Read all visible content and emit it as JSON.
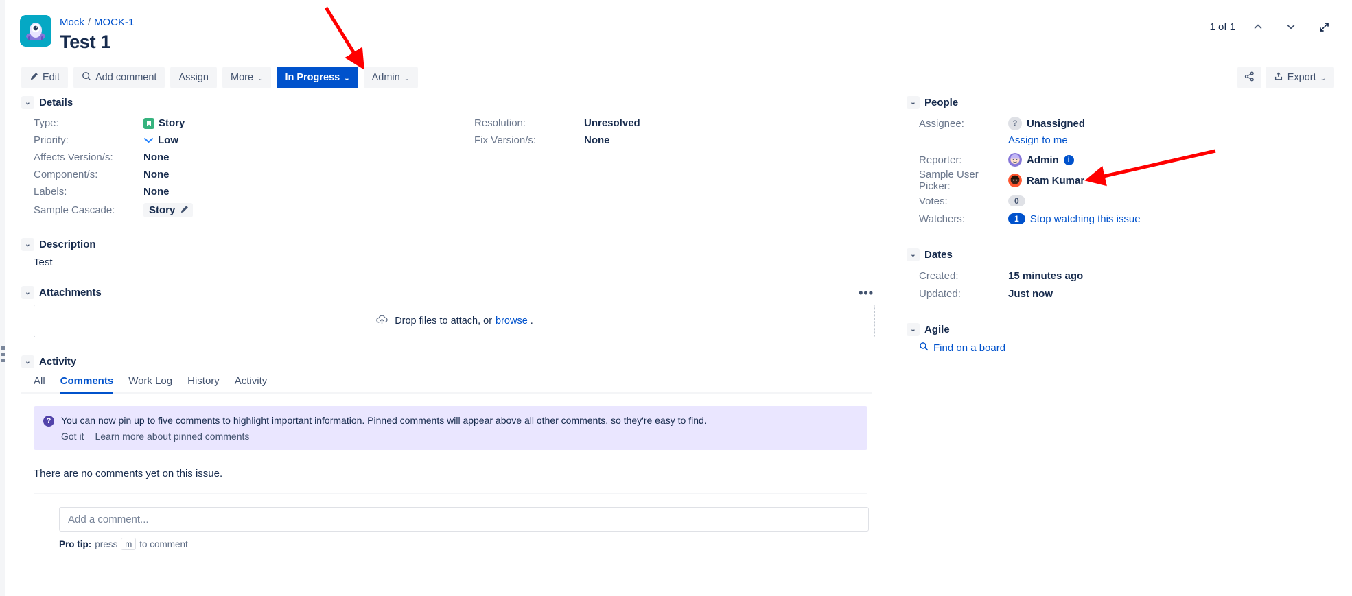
{
  "header": {
    "breadcrumb_project": "Mock",
    "breadcrumb_issue": "MOCK-1",
    "breadcrumb_separator": "/",
    "title": "Test 1",
    "pager_count": "1 of 1",
    "prev_icon": "chevron-up-icon",
    "next_icon": "chevron-down-icon",
    "expand_icon": "expand-icon",
    "project_avatar_icon": "project-avatar-icon"
  },
  "toolbar": {
    "edit_label": "Edit",
    "edit_icon": "pencil-icon",
    "add_comment_label": "Add comment",
    "add_comment_icon": "comment-icon",
    "assign_label": "Assign",
    "more_label": "More",
    "status_label": "In Progress",
    "admin_label": "Admin",
    "caret": "⌄",
    "share_icon": "share-icon",
    "export_label": "Export",
    "export_icon": "export-icon"
  },
  "details": {
    "heading": "Details",
    "left_rows": [
      {
        "label": "Type:",
        "value": "Story",
        "icon": "story-icon"
      },
      {
        "label": "Priority:",
        "value": "Low",
        "icon": "priority-low-icon"
      },
      {
        "label": "Affects Version/s:",
        "value": "None",
        "icon": ""
      },
      {
        "label": "Component/s:",
        "value": "None",
        "icon": ""
      },
      {
        "label": "Labels:",
        "value": "None",
        "icon": ""
      }
    ],
    "cascade_label": "Sample Cascade:",
    "cascade_value": "Story",
    "cascade_edit_icon": "pencil-icon",
    "right_rows": [
      {
        "label": "Resolution:",
        "value": "Unresolved"
      },
      {
        "label": "Fix Version/s:",
        "value": "None"
      }
    ]
  },
  "description": {
    "heading": "Description",
    "body": "Test"
  },
  "attachments": {
    "heading": "Attachments",
    "more_icon": "ellipsis-icon",
    "dropzone_text": "Drop files to attach, or",
    "dropzone_link": "browse",
    "dropzone_suffix": ".",
    "upload_icon": "cloud-upload-icon"
  },
  "activity": {
    "heading": "Activity",
    "tabs": [
      {
        "label": "All",
        "active": false
      },
      {
        "label": "Comments",
        "active": true
      },
      {
        "label": "Work Log",
        "active": false
      },
      {
        "label": "History",
        "active": false
      },
      {
        "label": "Activity",
        "active": false
      }
    ],
    "notice": {
      "icon": "question-icon",
      "text": "You can now pin up to five comments to highlight important information. Pinned comments will appear above all other comments, so they're easy to find.",
      "dismiss_label": "Got it",
      "learn_more_label": "Learn more about pinned comments"
    },
    "empty_text": "There are no comments yet on this issue.",
    "comment_placeholder": "Add a comment...",
    "protip_prefix": "Pro tip:",
    "protip_press": "press",
    "protip_key": "m",
    "protip_suffix": "to comment"
  },
  "people": {
    "heading": "People",
    "assignee_label": "Assignee:",
    "assignee_value": "Unassigned",
    "assignee_avatar_icon": "unassigned-avatar-icon",
    "assign_to_me_label": "Assign to me",
    "reporter_label": "Reporter:",
    "reporter_value": "Admin",
    "reporter_avatar_icon": "admin-avatar-icon",
    "reporter_info_icon": "info-icon",
    "user_picker_label": "Sample User Picker:",
    "user_picker_value": "Ram Kumar",
    "user_picker_avatar_icon": "ram-kumar-avatar-icon",
    "votes_label": "Votes:",
    "votes_value": "0",
    "watchers_label": "Watchers:",
    "watchers_count": "1",
    "watchers_action": "Stop watching this issue"
  },
  "dates": {
    "heading": "Dates",
    "created_label": "Created:",
    "created_value": "15 minutes ago",
    "updated_label": "Updated:",
    "updated_value": "Just now"
  },
  "agile": {
    "heading": "Agile",
    "find_board_label": "Find on a board",
    "search_icon": "search-icon"
  },
  "colors": {
    "primary": "#0052cc",
    "link": "#0052cc",
    "story_green": "#36b37e",
    "notice_bg": "#eae6ff",
    "annotation_arrow": "#ff0000"
  }
}
